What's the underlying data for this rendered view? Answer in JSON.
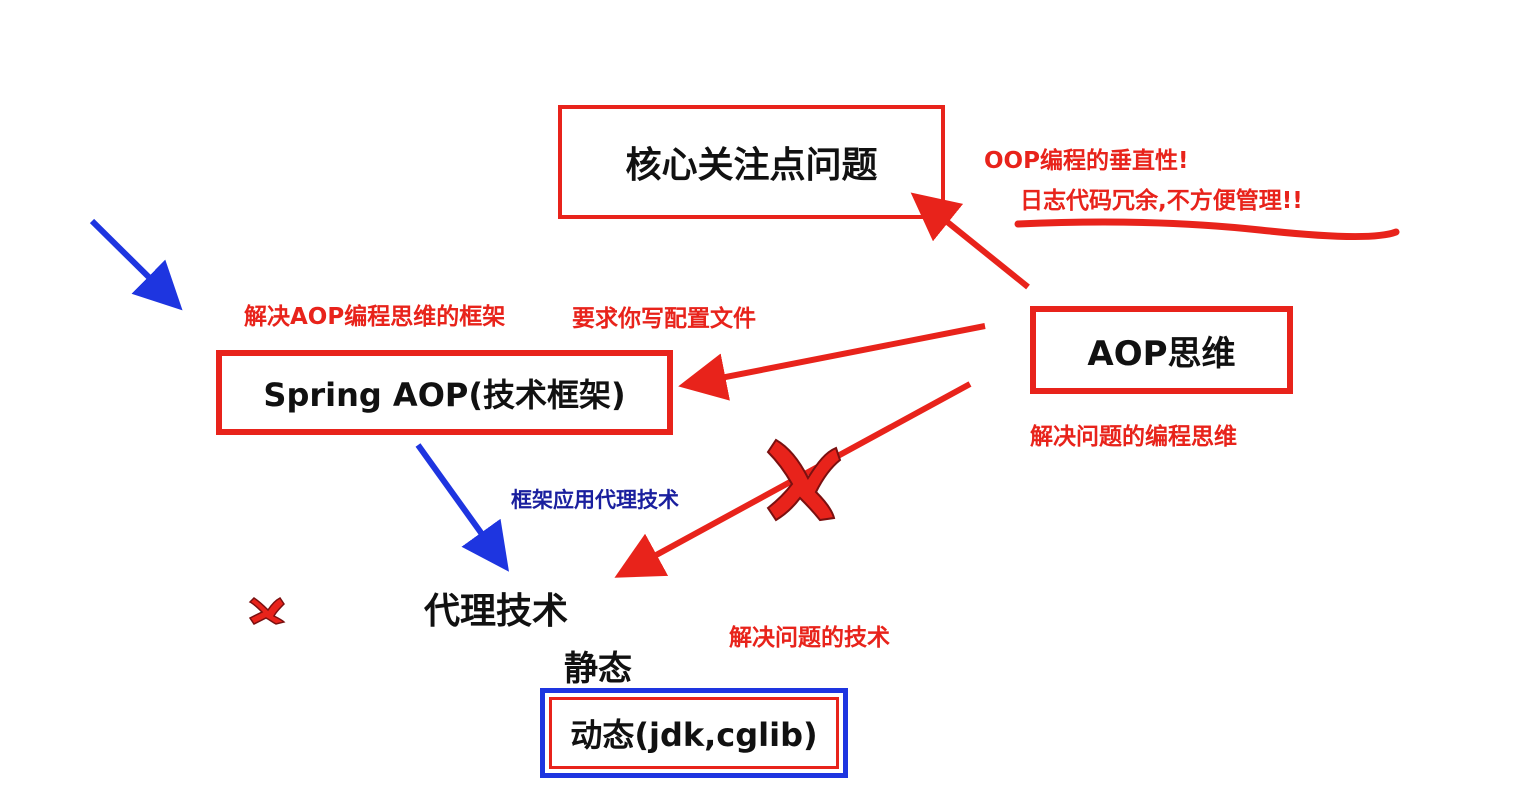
{
  "nodes": {
    "core_concern": "核心关注点问题",
    "aop_thinking": "AOP思维",
    "spring_aop": "Spring AOP(技术框架)",
    "proxy_tech": "代理技术",
    "static_label": "静态",
    "dynamic": "动态(jdk,cglib)"
  },
  "notes": {
    "oop_vertical": "OOP编程的垂直性!",
    "log_redundant": "日志代码冗余,不方便管理!!",
    "solve_aop_framework": "解决AOP编程思维的框架",
    "require_config": "要求你写配置文件",
    "solve_problem_thinking": "解决问题的编程思维",
    "framework_uses_proxy": "框架应用代理技术",
    "solve_problem_tech": "解决问题的技术"
  },
  "colors": {
    "red": "#e8231b",
    "blue": "#1a1f9e",
    "arrow_blue": "#1e35e0",
    "text": "#111111"
  },
  "icons": [
    "red-cross-mark-icon",
    "small-red-cross-mark-icon"
  ]
}
